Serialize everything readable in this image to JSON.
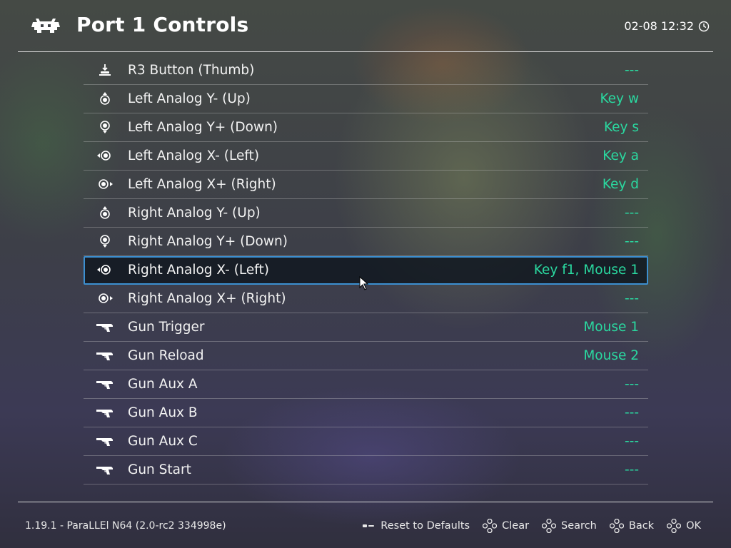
{
  "header": {
    "title": "Port 1 Controls",
    "clock": "02-08 12:32"
  },
  "rows": [
    {
      "icon": "r3-button-icon",
      "label": "R3 Button (Thumb)",
      "value": "---"
    },
    {
      "icon": "analog-up-icon",
      "label": "Left Analog Y- (Up)",
      "value": "Key w"
    },
    {
      "icon": "analog-down-icon",
      "label": "Left Analog Y+ (Down)",
      "value": "Key s"
    },
    {
      "icon": "analog-left-icon",
      "label": "Left Analog X- (Left)",
      "value": "Key a"
    },
    {
      "icon": "analog-right-icon",
      "label": "Left Analog X+ (Right)",
      "value": "Key d"
    },
    {
      "icon": "analog-up-icon",
      "label": "Right Analog Y- (Up)",
      "value": "---"
    },
    {
      "icon": "analog-down-icon",
      "label": "Right Analog Y+ (Down)",
      "value": "---"
    },
    {
      "icon": "analog-left-icon",
      "label": "Right Analog X- (Left)",
      "value": "Key f1, Mouse 1"
    },
    {
      "icon": "analog-right-icon",
      "label": "Right Analog X+ (Right)",
      "value": "---"
    },
    {
      "icon": "gun-icon",
      "label": "Gun Trigger",
      "value": "Mouse 1"
    },
    {
      "icon": "gun-icon",
      "label": "Gun Reload",
      "value": "Mouse 2"
    },
    {
      "icon": "gun-icon",
      "label": "Gun Aux A",
      "value": "---"
    },
    {
      "icon": "gun-icon",
      "label": "Gun Aux B",
      "value": "---"
    },
    {
      "icon": "gun-icon",
      "label": "Gun Aux C",
      "value": "---"
    },
    {
      "icon": "gun-icon",
      "label": "Gun Start",
      "value": "---"
    }
  ],
  "selected_row_label": "Right Analog X- (Left)",
  "footer": {
    "version": "1.19.1 - ParaLLEl N64 (2.0-rc2 334998e)",
    "actions": [
      {
        "icon": "select-button-icon",
        "label": "Reset to Defaults"
      },
      {
        "icon": "dpad-icon",
        "label": "Clear"
      },
      {
        "icon": "dpad-icon",
        "label": "Search"
      },
      {
        "icon": "dpad-icon",
        "label": "Back"
      },
      {
        "icon": "dpad-icon",
        "label": "OK"
      }
    ]
  },
  "colors": {
    "value_text": "#2ad9a0",
    "selection_border": "#3c8fd0",
    "text": "#f2f2f2"
  }
}
